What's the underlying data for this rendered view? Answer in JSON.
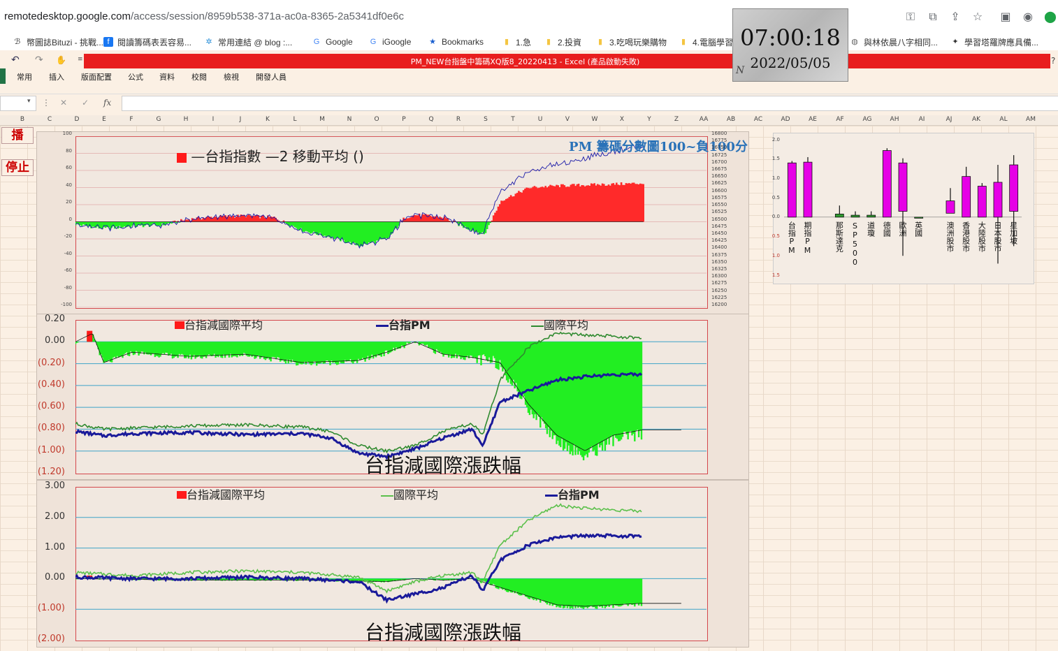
{
  "browser": {
    "url_host": "remotedesktop.google.com",
    "url_path": "/access/session/8959b538-371a-ac0a-8365-2a5341df0e6c",
    "icons": [
      "key-icon",
      "open-external-icon",
      "share-icon",
      "star-icon",
      "screen-icon",
      "chat-icon",
      "remote-icon"
    ]
  },
  "bookmarks": [
    {
      "label": "幣圖誌Bituzi - 挑戰...",
      "icon": "bituzi-icon"
    },
    {
      "label": "閱讀籌碼表丟容易...",
      "icon": "facebook-icon"
    },
    {
      "label": "常用連結 @ blog :...",
      "icon": "blog-icon"
    },
    {
      "label": "Google",
      "icon": "google-icon"
    },
    {
      "label": "iGoogle",
      "icon": "google-icon"
    },
    {
      "label": "Bookmarks",
      "icon": "star-icon"
    },
    {
      "label": "1.急",
      "icon": "folder-icon"
    },
    {
      "label": "2.投資",
      "icon": "folder-icon"
    },
    {
      "label": "3.吃喝玩樂購物",
      "icon": "folder-icon"
    },
    {
      "label": "4.電腦學習",
      "icon": "folder-icon"
    },
    {
      "label": "與林依晨八字相同...",
      "icon": "globe-icon"
    },
    {
      "label": "學習塔羅牌應具備...",
      "icon": "tarot-icon"
    }
  ],
  "clock": {
    "time": "07:00:18",
    "date": "2022/05/05",
    "mark": "N"
  },
  "excel": {
    "title": "PM_NEW台指盤中籌碼XQ版8_20220413 - Excel (產品啟動失敗)",
    "help": "?",
    "tabs": [
      "常用",
      "插入",
      "版面配置",
      "公式",
      "資料",
      "校閱",
      "檢視",
      "開發人員"
    ],
    "formula_icons": {
      "cancel": "✕",
      "enter": "✓",
      "fx": "fx"
    },
    "columns": [
      "B",
      "C",
      "D",
      "E",
      "F",
      "G",
      "H",
      "I",
      "J",
      "K",
      "L",
      "M",
      "N",
      "O",
      "P",
      "Q",
      "R",
      "S",
      "T",
      "U",
      "V",
      "W",
      "X",
      "Y",
      "Z",
      "AA",
      "AB",
      "AC",
      "AD",
      "AE",
      "AF",
      "AG",
      "AH",
      "AI",
      "AJ",
      "AK",
      "AL",
      "AM"
    ],
    "buttons": {
      "play": "播",
      "stop": "停止"
    }
  },
  "colors": {
    "red": "#ff1a1a",
    "green": "#22ee22",
    "navy": "#1a1a9a",
    "darkgreen": "#2f8a2f",
    "magenta": "#e600e6",
    "cyan": "#3da3c8"
  },
  "chart_data": [
    {
      "type": "area",
      "title": "PM 籌碼分數圖100~負100分",
      "legend": [
        "台指指數",
        "2 移動平均 ()"
      ],
      "ylim": [
        -100,
        100
      ],
      "yticks": [
        "100",
        "80",
        "60",
        "40",
        "20",
        "0",
        "-20",
        "-40",
        "-60",
        "-80",
        "-100"
      ],
      "y2ticks": [
        "16800",
        "16775",
        "16750",
        "16725",
        "16700",
        "16675",
        "16650",
        "16625",
        "16600",
        "16575",
        "16550",
        "16525",
        "16500",
        "16475",
        "16450",
        "16425",
        "16400",
        "16375",
        "16350",
        "16325",
        "16300",
        "16275",
        "16250",
        "16225",
        "16200"
      ],
      "series": [
        {
          "name": "台指指數",
          "x": [
            0,
            5,
            10,
            15,
            20,
            25,
            30,
            35,
            40,
            45,
            50,
            55,
            58,
            60,
            62,
            65,
            68,
            72,
            75,
            80,
            85,
            90,
            95,
            100
          ],
          "values": [
            -3,
            -8,
            -5,
            -4,
            3,
            6,
            7,
            5,
            -10,
            -18,
            -28,
            -20,
            5,
            8,
            7,
            5,
            -5,
            -15,
            25,
            40,
            42,
            43,
            44,
            45
          ]
        }
      ]
    },
    {
      "type": "area",
      "title": "台指減國際漲跌幅",
      "legend": [
        "台指減國際平均",
        "台指PM",
        "國際平均"
      ],
      "ylim": [
        -1.2,
        0.2
      ],
      "yticks": [
        "0.20",
        "0.00",
        "(0.20)",
        "(0.40)",
        "(0.60)",
        "(0.80)",
        "(1.00)",
        "(1.20)"
      ],
      "series": [
        {
          "name": "台指減國際平均",
          "x": [
            0,
            3,
            5,
            10,
            20,
            30,
            40,
            50,
            55,
            60,
            65,
            70,
            75,
            80,
            85,
            90,
            95,
            100
          ],
          "values": [
            0.0,
            0.08,
            -0.2,
            -0.1,
            -0.14,
            -0.12,
            -0.2,
            -0.18,
            -0.1,
            0.0,
            -0.12,
            -0.15,
            -0.2,
            -0.6,
            -0.9,
            -1.05,
            -0.9,
            -0.85
          ]
        },
        {
          "name": "台指PM",
          "x": [
            0,
            5,
            10,
            20,
            30,
            40,
            45,
            50,
            55,
            60,
            65,
            70,
            72,
            75,
            80,
            85,
            90,
            95,
            100
          ],
          "values": [
            -0.82,
            -0.86,
            -0.84,
            -0.83,
            -0.85,
            -0.84,
            -0.88,
            -1.02,
            -1.05,
            -0.98,
            -0.88,
            -0.8,
            -0.95,
            -0.55,
            -0.45,
            -0.35,
            -0.32,
            -0.3,
            -0.3
          ]
        },
        {
          "name": "國際平均",
          "x": [
            0,
            5,
            10,
            20,
            30,
            40,
            45,
            50,
            55,
            60,
            65,
            70,
            72,
            75,
            80,
            85,
            90,
            95,
            100
          ],
          "values": [
            -0.75,
            -0.8,
            -0.79,
            -0.77,
            -0.76,
            -0.78,
            -0.82,
            -0.95,
            -1.0,
            -0.95,
            -0.82,
            -0.75,
            -0.85,
            -0.35,
            -0.05,
            0.08,
            0.06,
            0.05,
            0.03
          ]
        }
      ]
    },
    {
      "type": "area",
      "title": "台指減國際漲跌幅",
      "legend": [
        "台指減國際平均",
        "國際平均",
        "台指PM"
      ],
      "ylim": [
        -2,
        3
      ],
      "yticks": [
        "3.00",
        "2.00",
        "1.00",
        "0.00",
        "(1.00)",
        "(2.00)"
      ],
      "series": [
        {
          "name": "台指減國際平均",
          "x": [
            0,
            20,
            40,
            55,
            60,
            65,
            70,
            75,
            80,
            85,
            90,
            95,
            100
          ],
          "values": [
            0,
            -0.05,
            -0.05,
            -0.1,
            0,
            -0.05,
            0,
            -0.3,
            -0.6,
            -0.9,
            -0.95,
            -0.9,
            -0.85
          ]
        },
        {
          "name": "國際平均",
          "x": [
            0,
            10,
            20,
            30,
            40,
            50,
            55,
            60,
            65,
            70,
            72,
            75,
            80,
            85,
            90,
            95,
            100
          ],
          "values": [
            0.2,
            0.1,
            0.2,
            0.25,
            0.2,
            0.05,
            -0.4,
            -0.1,
            0.1,
            0.2,
            -0.1,
            1.1,
            1.9,
            2.4,
            2.3,
            2.25,
            2.2
          ]
        },
        {
          "name": "台指PM",
          "x": [
            0,
            10,
            20,
            30,
            40,
            50,
            55,
            60,
            65,
            70,
            72,
            75,
            80,
            85,
            90,
            95,
            100
          ],
          "values": [
            0.05,
            0,
            0.0,
            0.05,
            0.0,
            -0.1,
            -0.7,
            -0.5,
            -0.3,
            0.1,
            -0.4,
            0.6,
            1.1,
            1.35,
            1.4,
            1.4,
            1.38
          ]
        }
      ]
    },
    {
      "type": "candlestick",
      "ylim": [
        -1.5,
        2.0
      ],
      "yticks": [
        "2.0",
        "1.5",
        "1.0",
        "0.5",
        "0.0",
        "0.5",
        "1.0",
        "1.5"
      ],
      "categories": [
        "台指PM",
        "期指PM",
        "",
        "那斯達克",
        "SP500",
        "道瓊",
        "德國",
        "歐洲",
        "英國",
        "",
        "澳洲股市",
        "香港股市",
        "大陸股市",
        "日本股市",
        "星加坡"
      ],
      "values": [
        {
          "open": 0.0,
          "close": 1.4,
          "high": 1.45,
          "low": 0.0
        },
        {
          "open": 0.0,
          "close": 1.42,
          "high": 1.55,
          "low": 0.0
        },
        null,
        {
          "open": 0.0,
          "close": 0.08,
          "high": 0.3,
          "low": 0.0
        },
        {
          "open": 0.0,
          "close": 0.05,
          "high": 0.15,
          "low": 0.0
        },
        {
          "open": 0.0,
          "close": 0.05,
          "high": 0.15,
          "low": 0.0
        },
        {
          "open": 0.0,
          "close": 1.72,
          "high": 1.78,
          "low": 0.0
        },
        {
          "open": 0.15,
          "close": 1.4,
          "high": 1.52,
          "low": -1.0
        },
        {
          "open": 0.0,
          "close": 0.0,
          "high": 0.0,
          "low": 0.0
        },
        null,
        {
          "open": 0.1,
          "close": 0.42,
          "high": 0.75,
          "low": 0.1
        },
        {
          "open": 0.0,
          "close": 1.05,
          "high": 1.3,
          "low": 0.0
        },
        {
          "open": 0.0,
          "close": 0.8,
          "high": 0.88,
          "low": 0.0
        },
        {
          "open": 0.0,
          "close": 0.9,
          "high": 1.35,
          "low": -1.2
        },
        {
          "open": 0.15,
          "close": 1.35,
          "high": 1.6,
          "low": -0.75
        }
      ]
    }
  ]
}
